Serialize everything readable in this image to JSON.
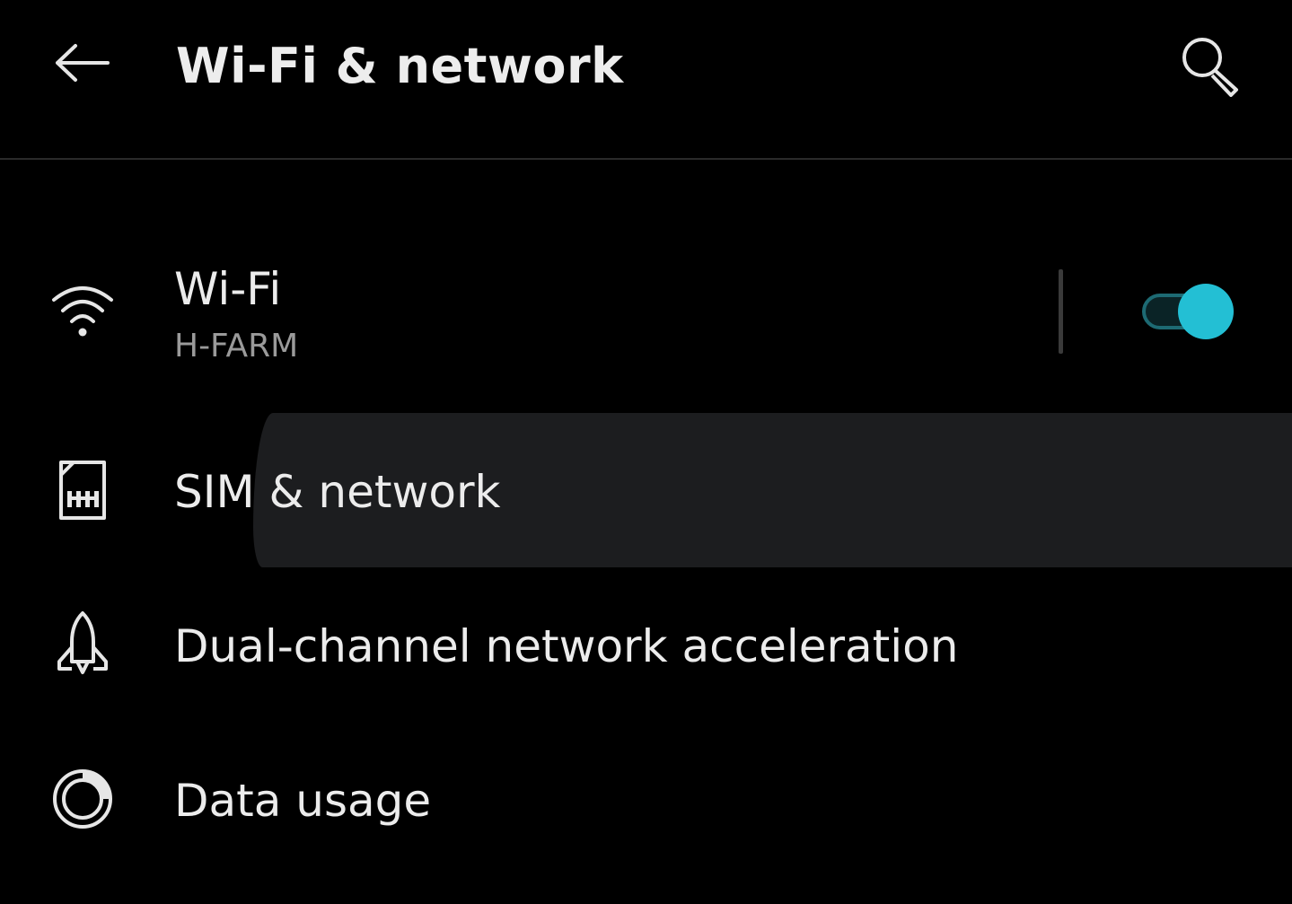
{
  "header": {
    "title": "Wi-Fi & network",
    "back_icon": "arrow-left-icon",
    "search_icon": "search-icon"
  },
  "rows": [
    {
      "title": "Wi-Fi",
      "subtitle": "H-FARM",
      "icon": "wifi-icon",
      "toggle_on": true
    },
    {
      "title": "SIM & network",
      "icon": "sim-card-icon"
    },
    {
      "title": "Dual-channel network acceleration",
      "icon": "rocket-icon"
    },
    {
      "title": "Data usage",
      "icon": "data-usage-icon"
    }
  ],
  "colors": {
    "background": "#000000",
    "accent": "#23bfd4",
    "text_primary": "#ececec",
    "text_secondary": "#9a9a9a",
    "pressed_row": "#1c1d1f"
  }
}
